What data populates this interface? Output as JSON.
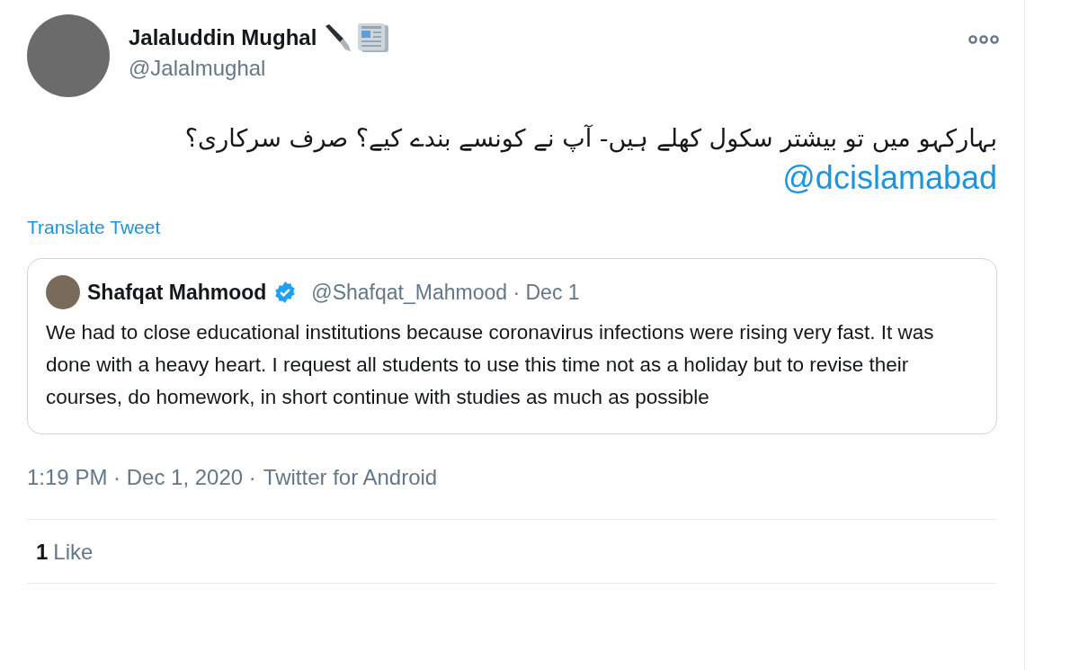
{
  "tweet": {
    "author": {
      "name": "Jalaluddin Mughal",
      "handle": "@Jalalmughal"
    },
    "text": "بہارکہو میں تو بیشتر سکول کھلے ہیں- آپ نے کونسے بندے کیے؟ صرف سرکاری؟",
    "mention": "@dcislamabad",
    "translate": "Translate Tweet",
    "quote": {
      "name": "Shafqat Mahmood",
      "verified": true,
      "handle": "@Shafqat_Mahmood",
      "separator": "·",
      "date": "Dec 1",
      "text": "We had to close educational institutions because coronavirus infections were rising very fast. It was done with a heavy heart. I request all students to use this time not as a holiday but to revise their courses, do homework, in short continue with studies as much as possible"
    },
    "meta": {
      "time": "1:19 PM",
      "date": "Dec 1, 2020",
      "source": "Twitter for Android",
      "separator": "·"
    },
    "stats": {
      "likes_count": "1",
      "likes_label": "Like"
    }
  }
}
